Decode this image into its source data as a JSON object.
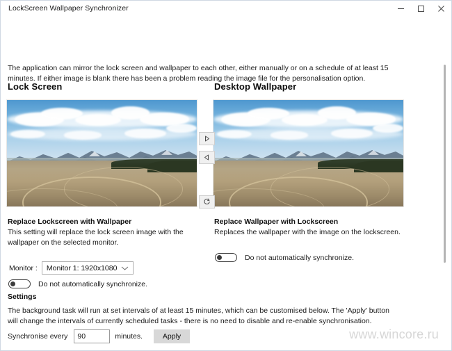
{
  "window": {
    "title": "LockScreen Wallpaper Synchronizer",
    "controls": {
      "minimize": "minimize-icon",
      "maximize": "maximize-icon",
      "close": "close-icon"
    }
  },
  "main": {
    "intro": "The application can mirror the lock screen and wallpaper to each other, either manually or on a schedule of at least 15 minutes. If either image is blank there has been a problem reading the image file for the personalisation option.",
    "columns": {
      "left_heading": "Lock Screen",
      "right_heading": "Desktop Wallpaper"
    },
    "transfer_buttons": [
      {
        "name": "copy-to-right-button",
        "icon": "triangle-right-icon"
      },
      {
        "name": "copy-to-left-button",
        "icon": "triangle-left-icon"
      },
      {
        "name": "refresh-button",
        "icon": "refresh-icon"
      }
    ]
  },
  "left_panel": {
    "heading": "Replace Lockscreen with Wallpaper",
    "description": "This setting will replace the lock screen image with the wallpaper on the selected monitor.",
    "monitor_label": "Monitor :",
    "monitor_value": "Monitor 1: 1920x1080",
    "monitor_options": [
      "Monitor 1: 1920x1080"
    ],
    "toggle_label": "Do not automatically synchronize.",
    "toggle_state": "off"
  },
  "right_panel": {
    "heading": "Replace Wallpaper with Lockscreen",
    "description": "Replaces the wallpaper with the image on the lockscreen.",
    "toggle_label": "Do not automatically synchronize.",
    "toggle_state": "off"
  },
  "settings": {
    "heading": "Settings",
    "description": "The background task will run at set intervals of at least 15 minutes, which can be customised below. The 'Apply' button will change the intervals of currently scheduled tasks - there is no need to disable and re-enable synchronisation.",
    "sync_label": "Synchronise every",
    "sync_value": "90",
    "sync_placeholder": "90",
    "sync_unit": "minutes.",
    "apply_label": "Apply"
  },
  "watermark": "www.wincore.ru",
  "colors": {
    "window_border": "#cfd8e3",
    "text": "#1b1b1b",
    "button_face": "#d8d8d8",
    "scrollbar_thumb": "#b4b4b4",
    "toggle_stroke": "#3b3b3b"
  }
}
